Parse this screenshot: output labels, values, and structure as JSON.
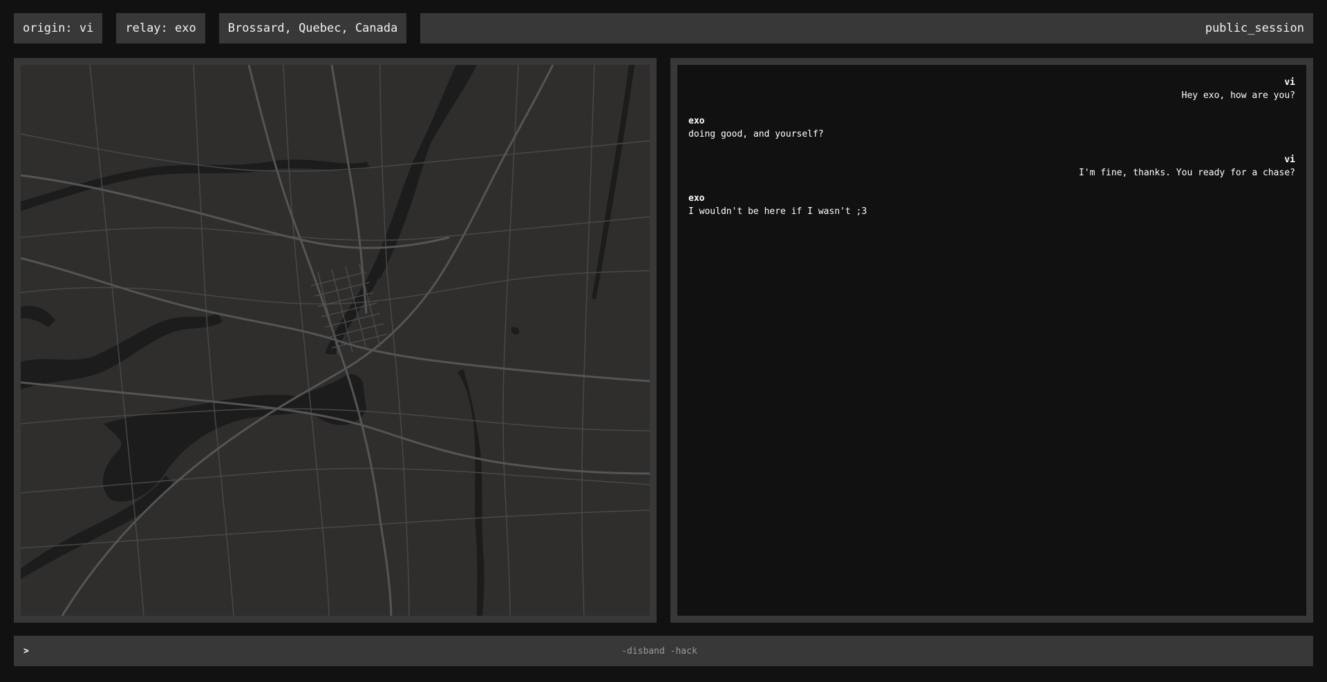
{
  "header": {
    "origin": "origin: vi",
    "relay": "relay: exo",
    "location": "Brossard, Quebec, Canada",
    "session": "public_session"
  },
  "map": {
    "land_color": "#2f2e2c",
    "water_color": "#1b1c1b",
    "road_color": "#4a4a4a",
    "major_road_color": "#555555"
  },
  "chat": {
    "messages": [
      {
        "sender": "vi",
        "text": "Hey exo, how are you?",
        "align": "right"
      },
      {
        "sender": "exo",
        "text": "doing good, and yourself?",
        "align": "left"
      },
      {
        "sender": "vi",
        "text": "I'm fine, thanks. You ready for a chase?",
        "align": "right"
      },
      {
        "sender": "exo",
        "text": "I wouldn't be here if I wasn't ;3",
        "align": "left"
      }
    ]
  },
  "command": {
    "prompt": ">",
    "placeholder": "-disband -hack",
    "value": ""
  }
}
